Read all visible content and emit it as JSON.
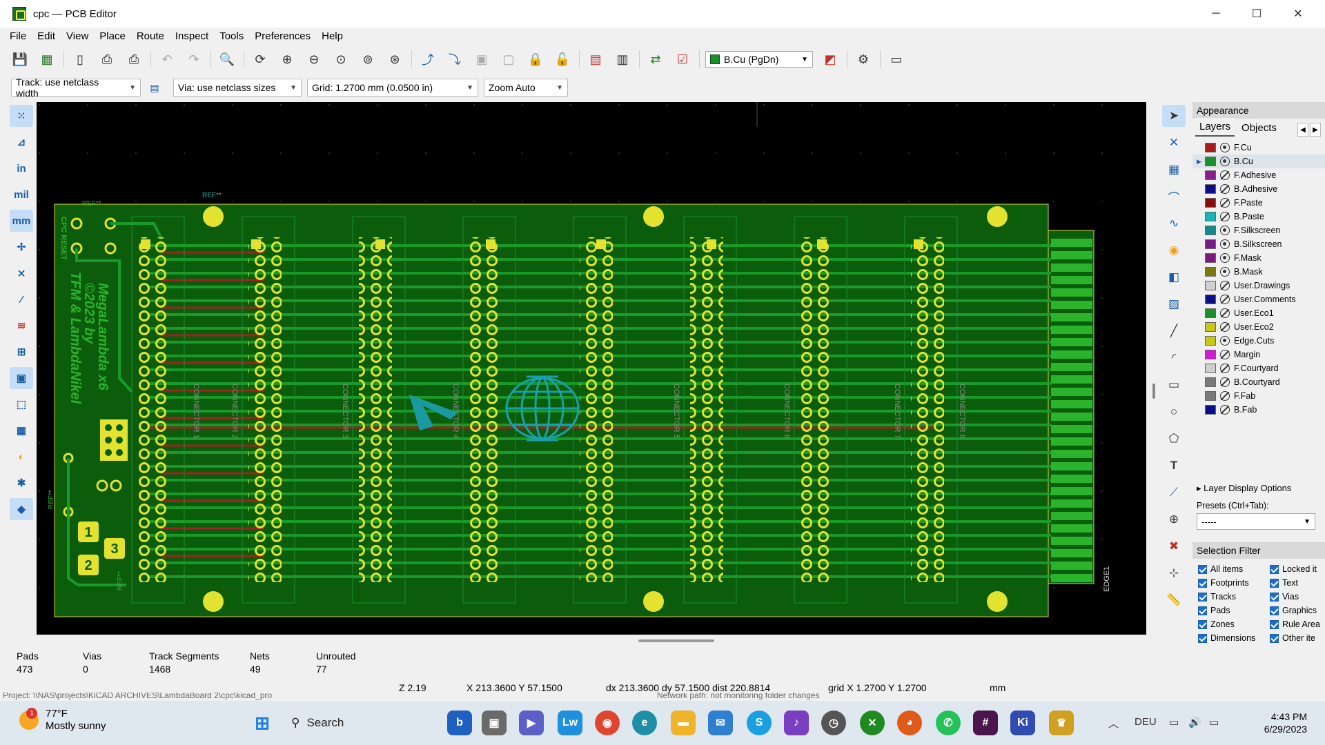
{
  "window": {
    "title": "cpc — PCB Editor",
    "minimize": "─",
    "maximize": "☐",
    "close": "✕"
  },
  "menu": [
    "File",
    "Edit",
    "View",
    "Place",
    "Route",
    "Inspect",
    "Tools",
    "Preferences",
    "Help"
  ],
  "toolbar": {
    "icons": [
      "save-icon",
      "board-setup-icon",
      "page-settings-icon",
      "print-icon",
      "plot-icon",
      "undo-icon",
      "redo-icon",
      "find-icon",
      "refresh-icon",
      "zoom-in-icon",
      "zoom-out-icon",
      "zoom-fit-icon",
      "zoom-objects-icon",
      "zoom-selection-icon",
      "flip-icon",
      "rotate-icon",
      "group-icon",
      "ungroup-icon",
      "lock-icon",
      "unlock-icon",
      "footprint-editor-icon",
      "footprint-browser-icon",
      "update-pcb-icon",
      "drc-icon"
    ],
    "active_layer": "B.Cu (PgDn)",
    "active_layer_color": "#1a8f2a"
  },
  "options": {
    "track": "Track: use netclass width",
    "via": "Via: use netclass sizes",
    "grid": "Grid: 1.2700 mm (0.0500 in)",
    "zoom": "Zoom Auto",
    "units": [
      "in",
      "mil",
      "mm"
    ]
  },
  "appearance": {
    "title": "Appearance",
    "tabs": [
      "Layers",
      "Objects"
    ],
    "layers": [
      {
        "name": "F.Cu",
        "color": "#a31d1d",
        "visible": true
      },
      {
        "name": "B.Cu",
        "color": "#1a8f2a",
        "visible": true,
        "selected": true
      },
      {
        "name": "F.Adhesive",
        "color": "#8a1d8a",
        "visible": false
      },
      {
        "name": "B.Adhesive",
        "color": "#0d0d8a",
        "visible": false
      },
      {
        "name": "F.Paste",
        "color": "#8a0d0d",
        "visible": false
      },
      {
        "name": "B.Paste",
        "color": "#17b7b7",
        "visible": false
      },
      {
        "name": "F.Silkscreen",
        "color": "#138a8a",
        "visible": true
      },
      {
        "name": "B.Silkscreen",
        "color": "#7a1a8a",
        "visible": true
      },
      {
        "name": "F.Mask",
        "color": "#7a1a7a",
        "visible": true
      },
      {
        "name": "B.Mask",
        "color": "#7a7a0d",
        "visible": true
      },
      {
        "name": "User.Drawings",
        "color": "#cfcfcf",
        "visible": false
      },
      {
        "name": "User.Comments",
        "color": "#0d0d8a",
        "visible": false
      },
      {
        "name": "User.Eco1",
        "color": "#1a8f2a",
        "visible": false
      },
      {
        "name": "User.Eco2",
        "color": "#c8c81a",
        "visible": false
      },
      {
        "name": "Edge.Cuts",
        "color": "#c8c81a",
        "visible": true
      },
      {
        "name": "Margin",
        "color": "#d11ad1",
        "visible": false
      },
      {
        "name": "F.Courtyard",
        "color": "#cfcfcf",
        "visible": false
      },
      {
        "name": "B.Courtyard",
        "color": "#7a7a7a",
        "visible": false
      },
      {
        "name": "F.Fab",
        "color": "#7a7a7a",
        "visible": false
      },
      {
        "name": "B.Fab",
        "color": "#0d0d8a",
        "visible": false
      }
    ],
    "layer_display_options": "Layer Display Options",
    "presets_label": "Presets (Ctrl+Tab):",
    "presets_value": "-----"
  },
  "selection_filter": {
    "title": "Selection Filter",
    "items": [
      "All items",
      "Locked it",
      "Footprints",
      "Text",
      "Tracks",
      "Vias",
      "Pads",
      "Graphics",
      "Zones",
      "Rule Area",
      "Dimensions",
      "Other ite"
    ]
  },
  "stats": [
    {
      "label": "Pads",
      "value": "473"
    },
    {
      "label": "Vias",
      "value": "0"
    },
    {
      "label": "Track Segments",
      "value": "1468"
    },
    {
      "label": "Nets",
      "value": "49"
    },
    {
      "label": "Unrouted",
      "value": "77"
    }
  ],
  "status": {
    "zoom": "Z 2.19",
    "xy": "X 213.3600  Y 57.1500",
    "delta": "dx 213.3600  dy 57.1500  dist 220.8814",
    "grid": "grid X 1.2700  Y 1.2700",
    "units": "mm",
    "project": "Project: \\\\NAS\\projects\\KiCAD ARCHIVES\\LambdaBoard 2\\cpc\\kicad_pro",
    "message": "Network path: not monitoring folder changes"
  },
  "pcb": {
    "ref_labels": [
      "REF**",
      "REF**",
      "REF**",
      "REF**"
    ],
    "board_text": [
      "MegaLambda x6",
      "©2023 by",
      "TFM & LambdaNikel"
    ],
    "side_text": "CPC RESET",
    "connector_labels": [
      "CONNECTOR 1",
      "CONNECTOR 2",
      "CONNECTOR 3",
      "CONNECTOR 4",
      "CONNECTOR 5",
      "CONNECTOR 6",
      "CONNECTOR 7",
      "CONNECTOR 8"
    ],
    "edge_label": "EDGE1",
    "numbers": [
      "1",
      "2",
      "3"
    ],
    "board_color": "#0b5d0b",
    "track_color": "#1a8f2a",
    "pad_color": "#d9d92a"
  },
  "taskbar": {
    "temperature": "77°F",
    "condition": "Mostly sunny",
    "weather_badge": "1",
    "search": "Search",
    "language": "DEU",
    "time": "4:43 PM",
    "date": "6/29/2023"
  }
}
